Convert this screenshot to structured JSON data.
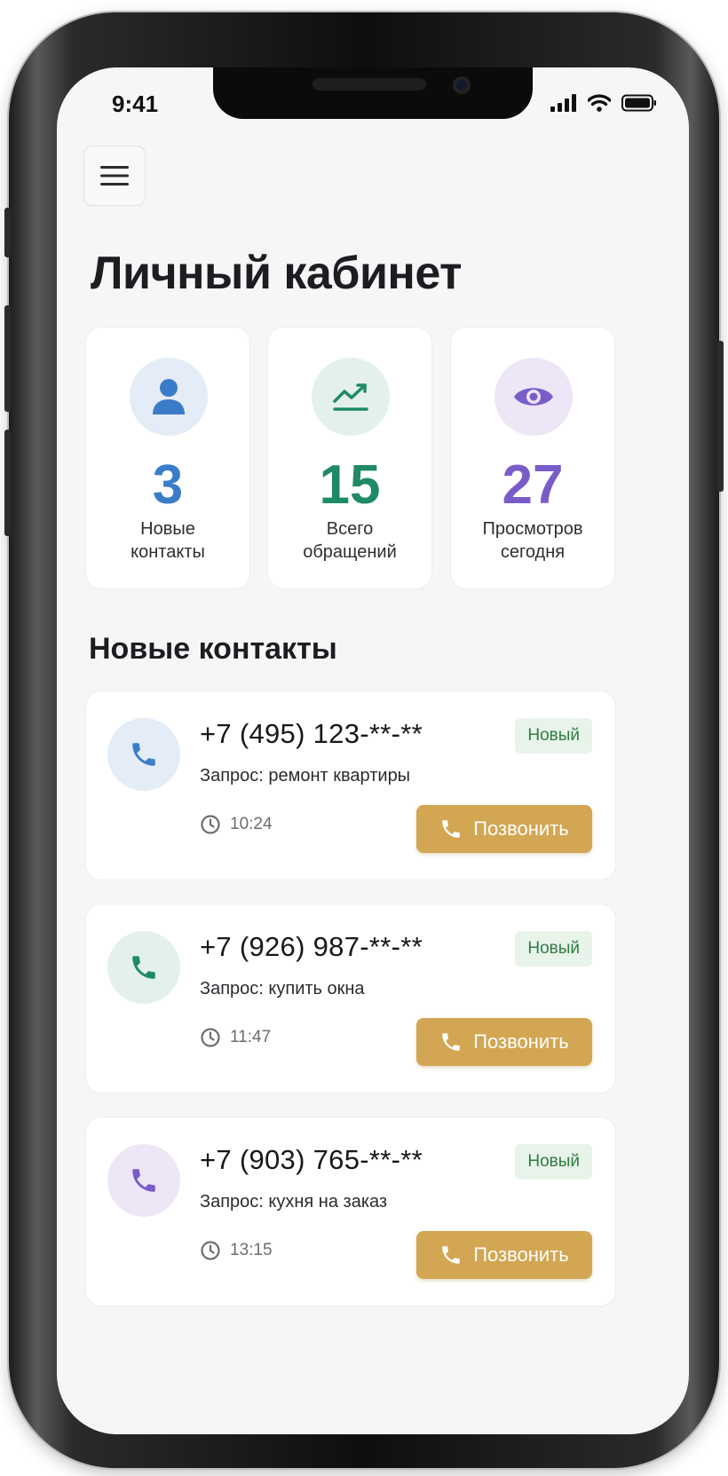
{
  "status_bar": {
    "time": "9:41"
  },
  "header": {
    "menu_icon": "menu-icon",
    "title": "Личный кабинет"
  },
  "stats": [
    {
      "value": "3",
      "label_line1": "Новые",
      "label_line2": "контакты",
      "icon": "user-icon",
      "color": "#3b7cc9",
      "icon_bg": "#e4ecf7"
    },
    {
      "value": "15",
      "label_line1": "Всего",
      "label_line2": "обращений",
      "icon": "trend-up-icon",
      "color": "#1f8a68",
      "icon_bg": "#e3f1ea"
    },
    {
      "value": "27",
      "label_line1": "Просмотров",
      "label_line2": "сегодня",
      "icon": "eye-icon",
      "color": "#7a5cc9",
      "icon_bg": "#ece6f7"
    }
  ],
  "section_title": "Новые контакты",
  "contacts": [
    {
      "phone": "+7 (495) 123-**-**",
      "request": "Запрос: ремонт квартиры",
      "time": "10:24",
      "badge": "Новый",
      "call_label": "Позвонить",
      "avatar_bg": "#e4ecf7",
      "avatar_color": "#3b7cc9"
    },
    {
      "phone": "+7 (926) 987-**-**",
      "request": "Запрос: купить окна",
      "time": "11:47",
      "badge": "Новый",
      "call_label": "Позвонить",
      "avatar_bg": "#e3f1ea",
      "avatar_color": "#1f8a68"
    },
    {
      "phone": "+7 (903) 765-**-**",
      "request": "Запрос: кухня на заказ",
      "time": "13:15",
      "badge": "Новый",
      "call_label": "Позвонить",
      "avatar_bg": "#ece6f7",
      "avatar_color": "#7a5cc9"
    }
  ],
  "colors": {
    "accent_button": "#d3a653",
    "badge_bg": "#e8f3ea",
    "badge_text": "#2f7d43"
  }
}
